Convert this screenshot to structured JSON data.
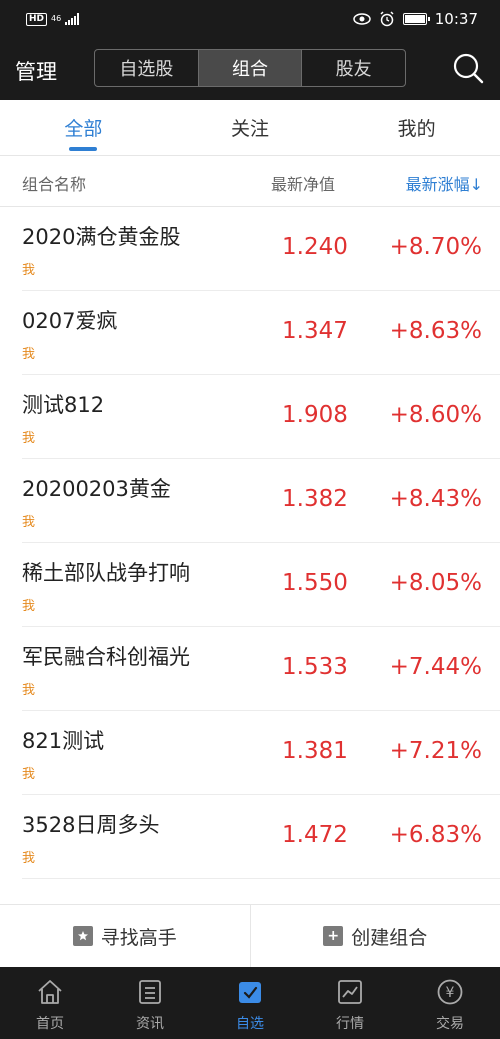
{
  "status_bar": {
    "hd": "HD",
    "network": "46",
    "time": "10:37"
  },
  "header": {
    "manage_label": "管理",
    "segments": [
      {
        "label": "自选股",
        "active": false
      },
      {
        "label": "组合",
        "active": true
      },
      {
        "label": "股友",
        "active": false
      }
    ]
  },
  "subtabs": [
    {
      "label": "全部",
      "active": true
    },
    {
      "label": "关注",
      "active": false
    },
    {
      "label": "我的",
      "active": false
    }
  ],
  "columns": {
    "name": "组合名称",
    "nav": "最新净值",
    "change": "最新涨幅↓"
  },
  "rows": [
    {
      "name": "2020满仓黄金股",
      "owner": "我",
      "nav": "1.240",
      "change": "+8.70%"
    },
    {
      "name": "0207爱疯",
      "owner": "我",
      "nav": "1.347",
      "change": "+8.63%"
    },
    {
      "name": "测试812",
      "owner": "我",
      "nav": "1.908",
      "change": "+8.60%"
    },
    {
      "name": "20200203黄金",
      "owner": "我",
      "nav": "1.382",
      "change": "+8.43%"
    },
    {
      "name": "稀土部队战争打响",
      "owner": "我",
      "nav": "1.550",
      "change": "+8.05%"
    },
    {
      "name": "军民融合科创福光",
      "owner": "我",
      "nav": "1.533",
      "change": "+7.44%"
    },
    {
      "name": "821测试",
      "owner": "我",
      "nav": "1.381",
      "change": "+7.21%"
    },
    {
      "name": "3528日周多头",
      "owner": "我",
      "nav": "1.472",
      "change": "+6.83%"
    }
  ],
  "actions": {
    "find_label": "寻找高手",
    "create_label": "创建组合"
  },
  "bottom_nav": [
    {
      "label": "首页",
      "icon": "home-icon",
      "active": false
    },
    {
      "label": "资讯",
      "icon": "news-icon",
      "active": false
    },
    {
      "label": "自选",
      "icon": "watchlist-icon",
      "active": true
    },
    {
      "label": "行情",
      "icon": "market-icon",
      "active": false
    },
    {
      "label": "交易",
      "icon": "trade-icon",
      "active": false
    }
  ],
  "colors": {
    "accent": "#2f7fd3",
    "up": "#e03131",
    "owner": "#e58a1f",
    "dark": "#1b1b1b"
  }
}
